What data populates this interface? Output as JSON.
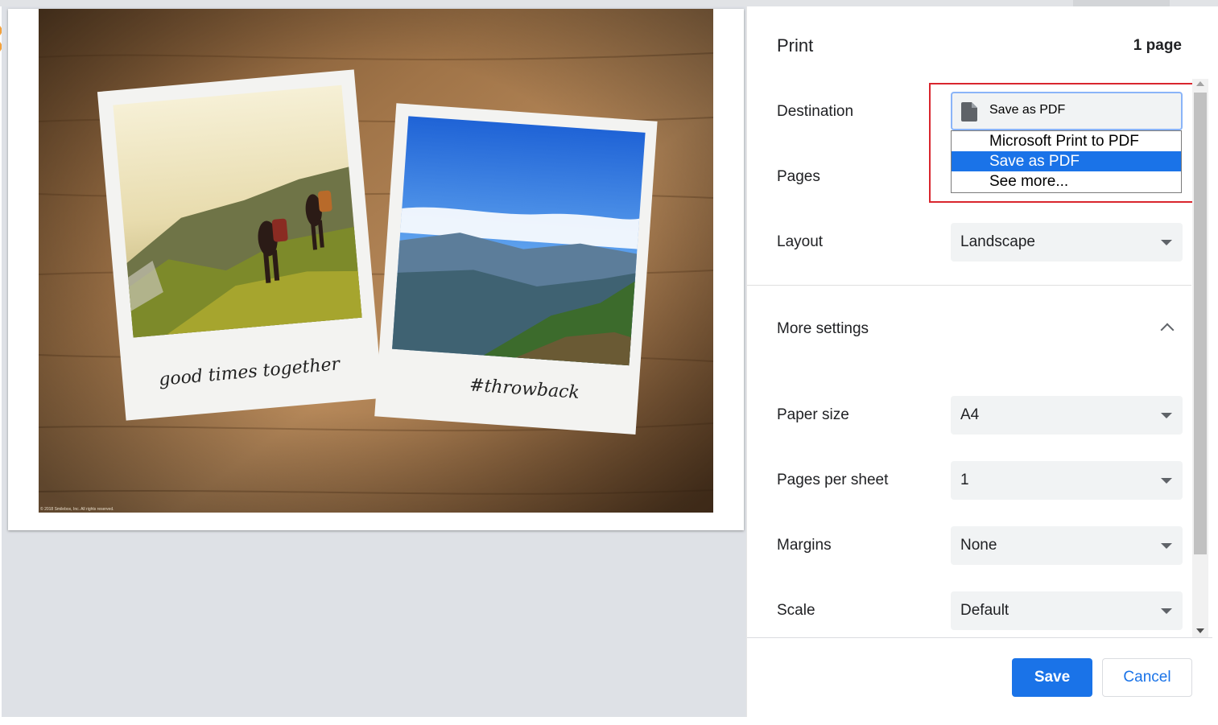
{
  "colors": {
    "accent": "#1a73e8",
    "highlight_border": "#d9262e",
    "focus_ring": "#8ab4f8"
  },
  "preview": {
    "caption_left": "good times together",
    "caption_right": "#throwback",
    "copyright": "© 2018 Smilebox, Inc. All rights reserved."
  },
  "header": {
    "title": "Print",
    "page_count": "1 page"
  },
  "destination": {
    "label": "Destination",
    "value": "Save as PDF",
    "icon": "document-icon",
    "options": [
      "Microsoft Print to PDF",
      "Save as PDF",
      "See more..."
    ],
    "selected_index": 1
  },
  "pages": {
    "label": "Pages"
  },
  "layout": {
    "label": "Layout",
    "value": "Landscape"
  },
  "more_settings": {
    "label": "More settings",
    "icon": "chevron-up-icon"
  },
  "paper_size": {
    "label": "Paper size",
    "value": "A4"
  },
  "pages_per_sheet": {
    "label": "Pages per sheet",
    "value": "1"
  },
  "margins": {
    "label": "Margins",
    "value": "None"
  },
  "scale": {
    "label": "Scale",
    "value": "Default"
  },
  "footer": {
    "save_label": "Save",
    "cancel_label": "Cancel"
  }
}
